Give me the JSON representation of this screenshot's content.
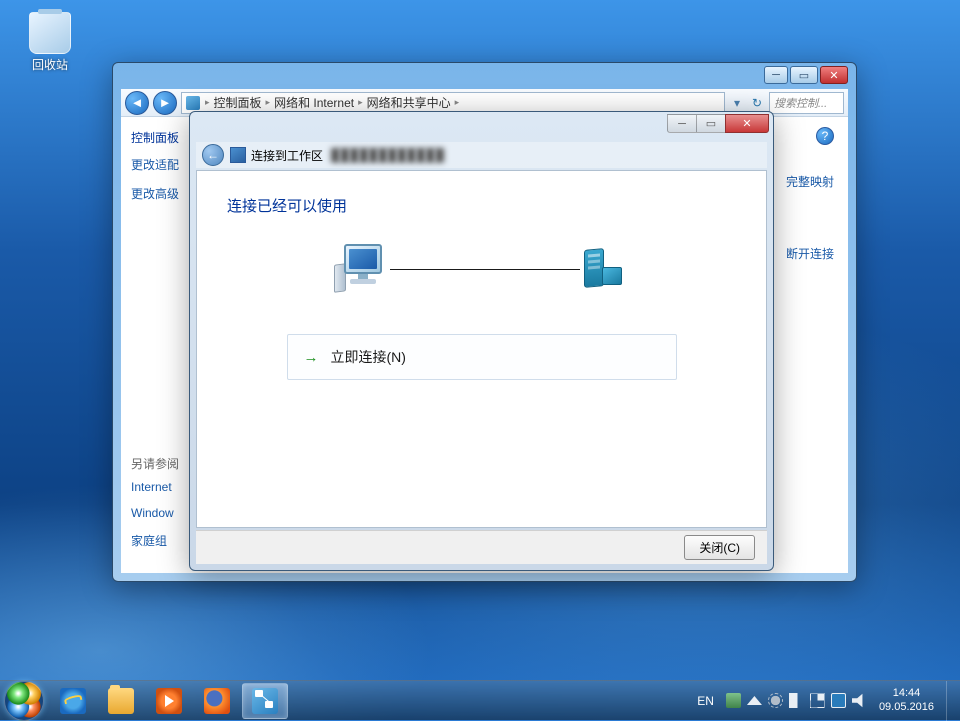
{
  "desktop": {
    "recycle_bin": "回收站"
  },
  "control_panel_window": {
    "breadcrumbs": [
      "控制面板",
      "网络和 Internet",
      "网络和共享中心"
    ],
    "search_placeholder": "搜索控制...",
    "sidebar": {
      "header": "控制面板",
      "links": [
        "更改适配",
        "更改高级"
      ],
      "see_also_header": "另请参阅",
      "see_also": [
        "Internet",
        "Window",
        "家庭组"
      ]
    },
    "partial_right_links": [
      "完整映射",
      "断开连接"
    ]
  },
  "wizard": {
    "title": "连接到工作区",
    "heading": "连接已经可以使用",
    "command_link": "立即连接(N)",
    "close_button": "关闭(C)"
  },
  "taskbar": {
    "language": "EN",
    "time": "14:44",
    "date": "09.05.2016"
  }
}
